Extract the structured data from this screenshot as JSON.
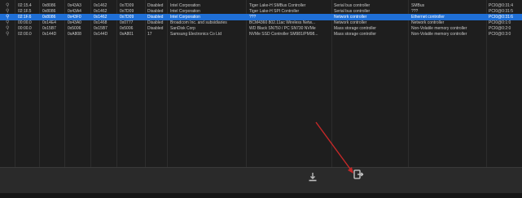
{
  "table": {
    "rows": [
      {
        "loc": "02:15.4",
        "vendor_id": "0x8086",
        "device_id": "0x43A3",
        "sub_vendor": "0x1462",
        "sub_device": "0x7D09",
        "link": "Disabled",
        "vendor": "Intel Corporation",
        "device": "Tiger Lake-H SMBus Controller",
        "class": "Serial bus controller",
        "subclass": "SMBus",
        "slot": "PCI0@0:31:4",
        "selected": false
      },
      {
        "loc": "02:1F.5",
        "vendor_id": "0x8086",
        "device_id": "0x43A4",
        "sub_vendor": "0x1462",
        "sub_device": "0x7D09",
        "link": "Disabled",
        "vendor": "Intel Corporation",
        "device": "Tiger Lake-H SPI Controller",
        "class": "Serial bus controller",
        "subclass": "???",
        "slot": "PCI0@0:31:5",
        "selected": false
      },
      {
        "loc": "02:1F.6",
        "vendor_id": "0x8086",
        "device_id": "0x43F0",
        "sub_vendor": "0x1462",
        "sub_device": "0x7D09",
        "link": "Disabled",
        "vendor": "Intel Corporation",
        "device": "???",
        "class": "Network controller",
        "subclass": "Ethernet controller",
        "slot": "PCI0@0:31:6",
        "selected": true
      },
      {
        "loc": "00:00.0",
        "vendor_id": "0x14E4",
        "device_id": "0x43A0",
        "sub_vendor": "0x1468",
        "sub_device": "0x0777",
        "link": "Disabled",
        "vendor": "Broadcom Inc. and subsidiaries",
        "device": "BCM4360 802.11ac Wireless Netw...",
        "class": "Network controller",
        "subclass": "Network controller",
        "slot": "PCI0@0:1:0",
        "selected": false
      },
      {
        "loc": "00:00.0",
        "vendor_id": "0x15B7",
        "device_id": "0x5006",
        "sub_vendor": "0x15B7",
        "sub_device": "0x5006",
        "link": "Disabled",
        "vendor": "SanDisk Corp",
        "device": "WD Black SN750 / PC SN730 NVMe",
        "class": "Mass storage controller",
        "subclass": "Non-Volatile memory controller",
        "slot": "PCI0@0:2:0",
        "selected": false
      },
      {
        "loc": "02:00.0",
        "vendor_id": "0x144D",
        "device_id": "0xA808",
        "sub_vendor": "0x144D",
        "sub_device": "0xA801",
        "link": "17",
        "vendor": "Samsung Electronics Co Ltd",
        "device": "NVMe SSD Controller SM981/PM98...",
        "class": "Mass storage controller",
        "subclass": "Non-Volatile memory controller",
        "slot": "PCI0@0:3:0",
        "selected": false
      }
    ]
  },
  "toolbar": {
    "left_icon": "download-icon",
    "right_icon": "export-icon"
  },
  "annotation": {
    "arrow_color": "#c62828"
  },
  "colors": {
    "selection": "#1f6fd6",
    "background": "#1e1e1e"
  }
}
